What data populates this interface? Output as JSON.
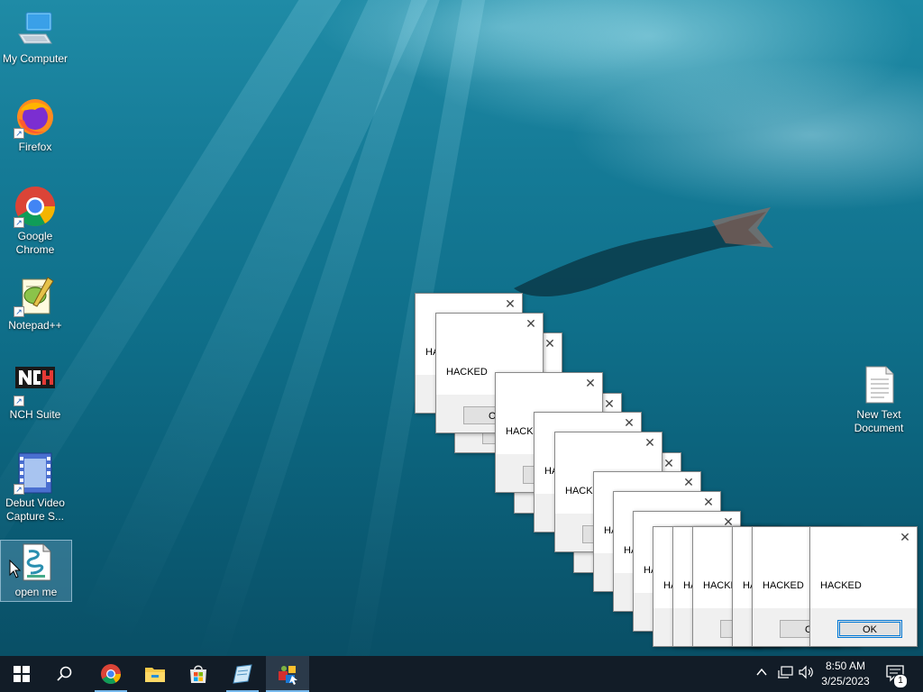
{
  "desktop": {
    "icons": [
      {
        "label": "My Computer",
        "icon": "computer-icon"
      },
      {
        "label": "Firefox",
        "icon": "firefox-icon"
      },
      {
        "label": "Google Chrome",
        "icon": "chrome-icon"
      },
      {
        "label": "Notepad++",
        "icon": "notepad-plus-plus-icon"
      },
      {
        "label": "NCH Suite",
        "icon": "nch-suite-icon"
      },
      {
        "label": "Debut Video Capture S...",
        "icon": "debut-video-icon"
      },
      {
        "label": "open me",
        "icon": "script-file-icon"
      },
      {
        "label": "New Text Document",
        "icon": "text-document-icon"
      }
    ]
  },
  "dialogs": {
    "message": "HACKED",
    "ok_label": "OK",
    "close_glyph": "✕",
    "count": 15
  },
  "taskbar": {
    "start_icon": "windows-start-icon",
    "search_icon": "search-icon",
    "pinned": [
      "chrome-icon",
      "file-explorer-icon",
      "microsoft-store-icon",
      "notepad-app-icon",
      "malware-app-icon"
    ],
    "tray": {
      "chevron_icon": "chevron-up-icon",
      "network_icon": "network-icon",
      "volume_icon": "volume-icon",
      "notification_icon": "notification-icon",
      "notification_count": "1"
    },
    "clock": {
      "time": "8:50 AM",
      "date": "3/25/2023"
    }
  }
}
